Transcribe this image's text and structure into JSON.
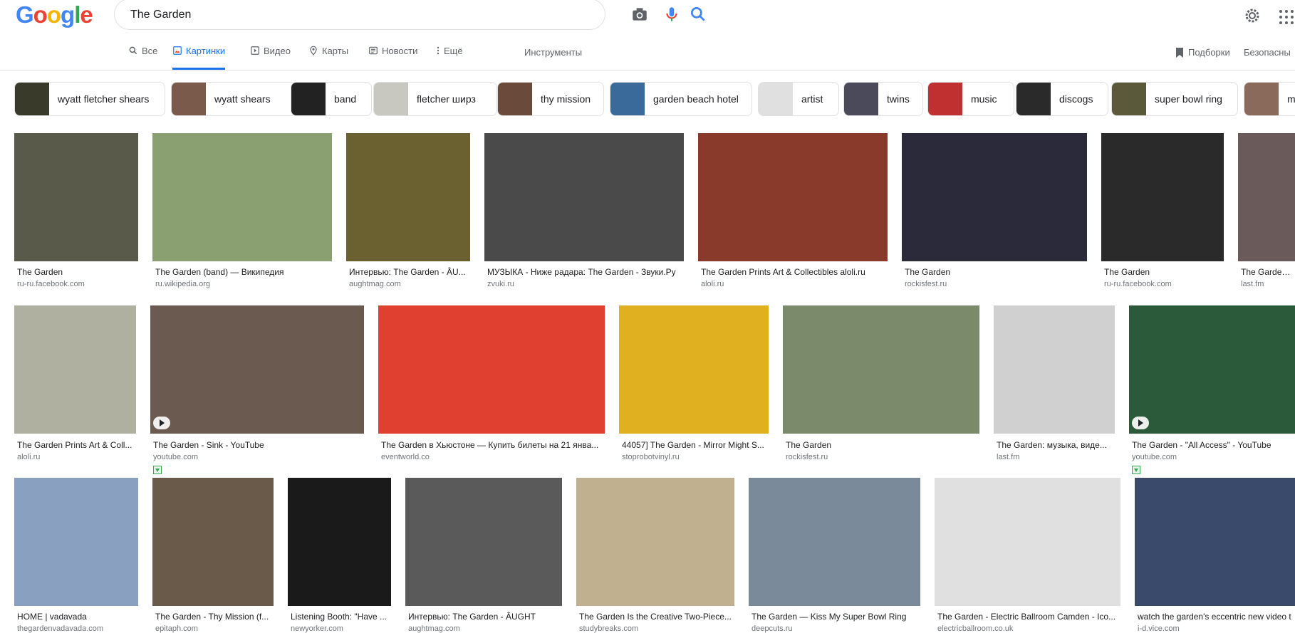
{
  "logo": {
    "letters": [
      "G",
      "o",
      "o",
      "g",
      "l",
      "e"
    ]
  },
  "search": {
    "value": "The Garden"
  },
  "tabs": [
    {
      "label": "Все",
      "icon": "search-icon"
    },
    {
      "label": "Картинки",
      "icon": "image-icon"
    },
    {
      "label": "Видео",
      "icon": "play-icon"
    },
    {
      "label": "Карты",
      "icon": "map-pin-icon"
    },
    {
      "label": "Новости",
      "icon": "news-icon"
    },
    {
      "label": "Ещё",
      "icon": "more-vert-icon"
    }
  ],
  "tools_label": "Инструменты",
  "collections_label": "Подборки",
  "safe_search_label": "Безопасны",
  "chips": [
    {
      "label": "wyatt fletcher shears",
      "color": "#3a3a2a"
    },
    {
      "label": "wyatt shears",
      "color": "#7a5a4a"
    },
    {
      "label": "band",
      "color": "#222222"
    },
    {
      "label": "fletcher ширз",
      "color": "#c8c8c0"
    },
    {
      "label": "thy mission",
      "color": "#6a4a3a"
    },
    {
      "label": "garden beach hotel",
      "color": "#3a6a9a"
    },
    {
      "label": "artist",
      "color": "#e0e0e0"
    },
    {
      "label": "twins",
      "color": "#4a4a5a"
    },
    {
      "label": "music",
      "color": "#c03030"
    },
    {
      "label": "discogs",
      "color": "#2a2a2a"
    },
    {
      "label": "super bowl ring",
      "color": "#5a5a3a"
    },
    {
      "label": "mac den",
      "color": "#8a6a5a"
    }
  ],
  "results": [
    {
      "title": "The Garden",
      "domain": "ru-ru.facebook.com",
      "color": "#5a5a4a"
    },
    {
      "title": "The Garden (band) — Википедия",
      "domain": "ru.wikipedia.org",
      "color": "#8aa070"
    },
    {
      "title": "Интервью: The Garden - ÂU...",
      "domain": "aughtmag.com",
      "color": "#6a6030"
    },
    {
      "title": "МУЗЫКА - Ниже радара: The Garden - Звуки.Ру",
      "domain": "zvuki.ru",
      "color": "#4a4a4a"
    },
    {
      "title": "The Garden Prints Art & Collectibles aloli.ru",
      "domain": "aloli.ru",
      "color": "#8a3a2a"
    },
    {
      "title": "The Garden",
      "domain": "rockisfest.ru",
      "color": "#2a2a3a"
    },
    {
      "title": "The Garden",
      "domain": "ru-ru.facebook.com",
      "color": "#2a2a2a"
    },
    {
      "title": "The Garden Ф",
      "domain": "last.fm",
      "color": "#6a5a5a"
    },
    {
      "title": "The Garden Prints Art & Coll...",
      "domain": "aloli.ru",
      "color": "#b0b0a0"
    },
    {
      "title": "The Garden - Sink - YouTube",
      "domain": "youtube.com",
      "color": "#6a5a50"
    },
    {
      "title": "The Garden в Хьюстоне — Купить билеты на 21 янва...",
      "domain": "eventworld.co",
      "color": "#e04030"
    },
    {
      "title": "44057] The Garden - Mirror Might S...",
      "domain": "stoprobotvinyl.ru",
      "color": "#e0b020"
    },
    {
      "title": "The Garden",
      "domain": "rockisfest.ru",
      "color": "#7a8a6a"
    },
    {
      "title": "The Garden: музыка, виде...",
      "domain": "last.fm",
      "color": "#d0d0d0"
    },
    {
      "title": "The Garden - \"All Access\" - YouTube",
      "domain": "youtube.com",
      "color": "#2a5a3a"
    },
    {
      "title": "HOME | vadavada",
      "domain": "thegardenvadavada.com",
      "color": "#8aa0c0"
    },
    {
      "title": "The Garden - Thy Mission (f...",
      "domain": "epitaph.com",
      "color": "#6a5a4a"
    },
    {
      "title": "Listening Booth: \"Have ...",
      "domain": "newyorker.com",
      "color": "#1a1a1a"
    },
    {
      "title": "Интервью: The Garden - ÂUGHT",
      "domain": "aughtmag.com",
      "color": "#5a5a5a"
    },
    {
      "title": "The Garden Is the Creative Two-Piece...",
      "domain": "studybreaks.com",
      "color": "#c0b090"
    },
    {
      "title": "The Garden — Kiss My Super Bowl Ring",
      "domain": "deepcuts.ru",
      "color": "#7a8a9a"
    },
    {
      "title": "The Garden - Electric Ballroom Camden - Ico...",
      "domain": "electricballroom.co.uk",
      "color": "#e0e0e0"
    },
    {
      "title": "watch the garden's eccentric new video t",
      "domain": "i-d.vice.com",
      "color": "#3a4a6a"
    }
  ]
}
